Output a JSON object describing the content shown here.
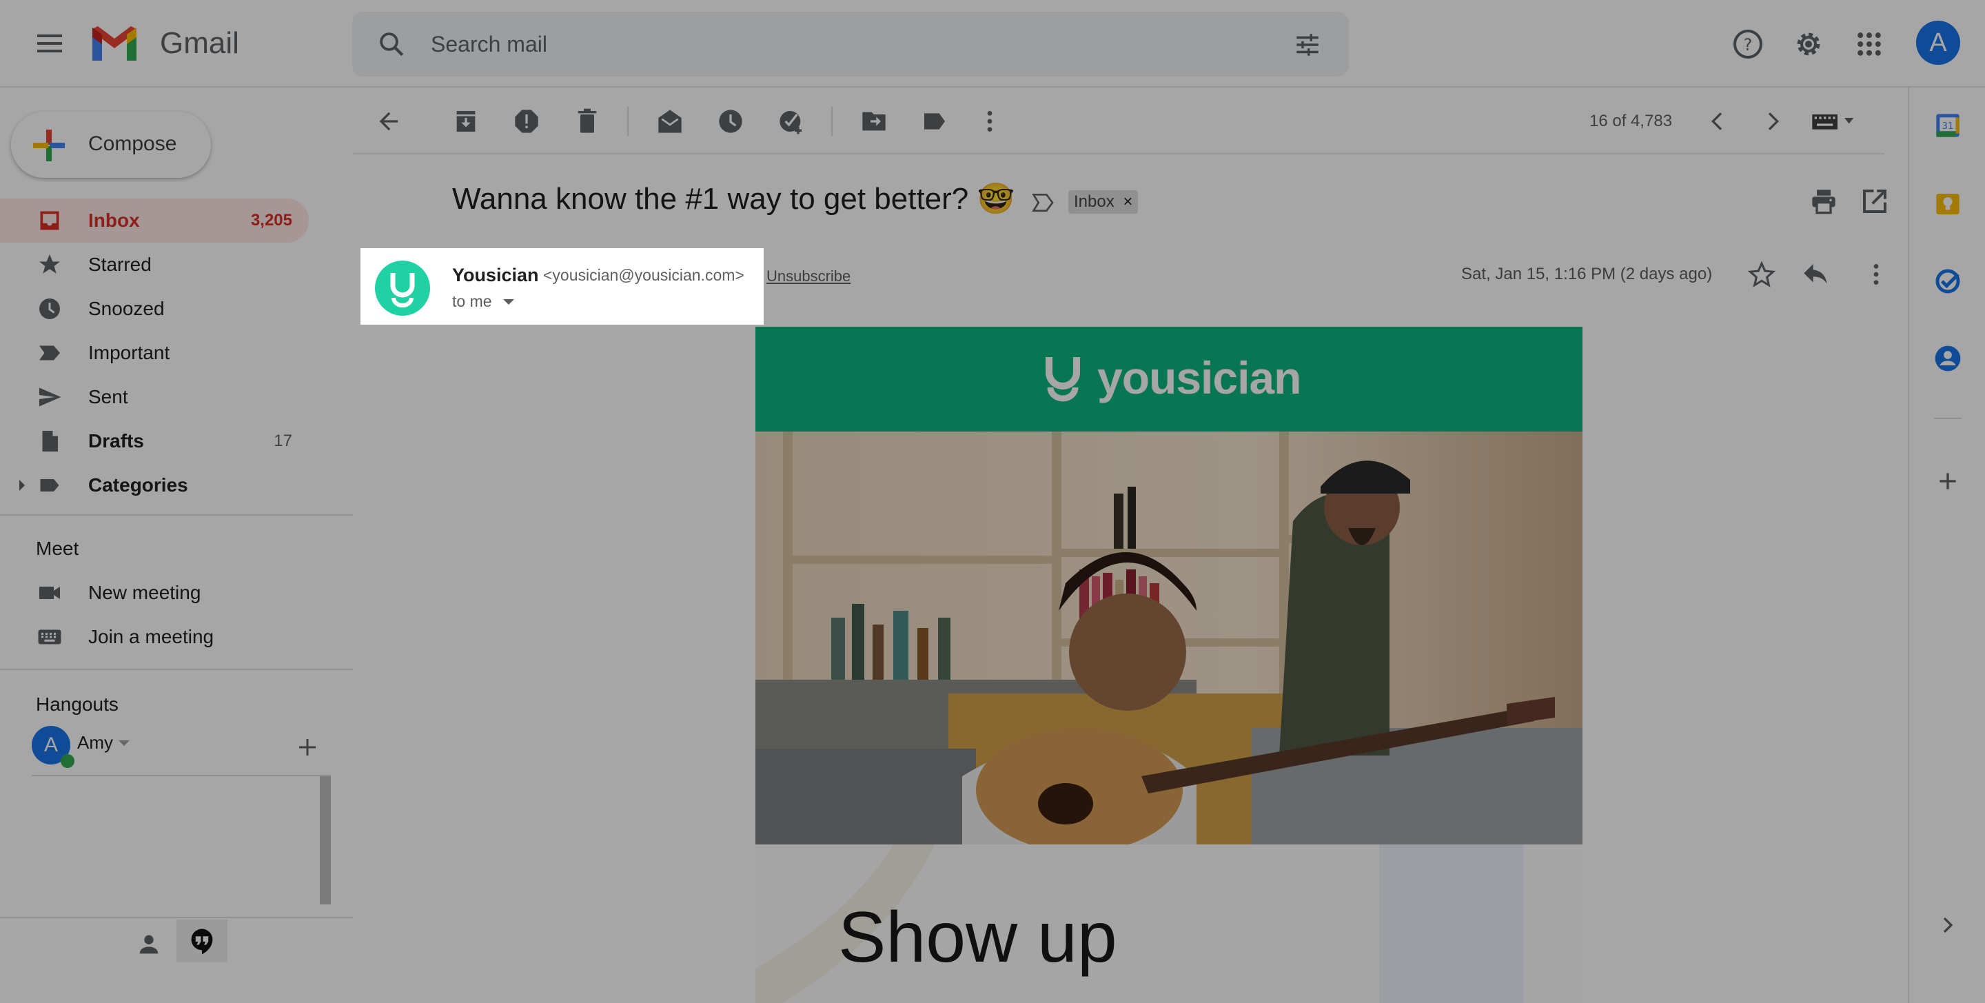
{
  "app": {
    "name": "Gmail",
    "colors": {
      "brand_red": "#d93025",
      "accent_blue": "#1a73e8",
      "yousician_green": "#0db580",
      "online_green": "#34a853"
    }
  },
  "header": {
    "menu_icon": "hamburger-menu-icon",
    "logo_text": "Gmail",
    "search": {
      "placeholder": "Search mail",
      "value": ""
    },
    "icons": [
      "search-icon",
      "filter-options-icon",
      "help-icon",
      "settings-gear-icon",
      "google-apps-icon"
    ],
    "account_initial": "A"
  },
  "sidebar": {
    "compose_label": "Compose",
    "items": [
      {
        "label": "Inbox",
        "count": "3,205",
        "icon": "inbox-icon",
        "active": true
      },
      {
        "label": "Starred",
        "count": "",
        "icon": "star-icon"
      },
      {
        "label": "Snoozed",
        "count": "",
        "icon": "clock-icon"
      },
      {
        "label": "Important",
        "count": "",
        "icon": "important-icon"
      },
      {
        "label": "Sent",
        "count": "",
        "icon": "send-icon"
      },
      {
        "label": "Drafts",
        "count": "17",
        "icon": "draft-icon",
        "bold": true
      },
      {
        "label": "Categories",
        "count": "",
        "icon": "label-icon",
        "bold": true,
        "expandable": true
      }
    ],
    "meet": {
      "title": "Meet",
      "items": [
        {
          "label": "New meeting",
          "icon": "video-camera-icon"
        },
        {
          "label": "Join a meeting",
          "icon": "keyboard-icon"
        }
      ]
    },
    "hangouts": {
      "title": "Hangouts",
      "user": {
        "initial": "A",
        "name": "Amy",
        "status": "online"
      }
    }
  },
  "toolbar": {
    "actions": [
      "Back to Inbox",
      "Archive",
      "Report spam",
      "Delete",
      "Mark as unread",
      "Snooze",
      "Add to Tasks",
      "Move to",
      "Labels",
      "More"
    ],
    "pager": "16 of 4,783"
  },
  "email": {
    "subject": "Wanna know the #1 way to get better? 🤓",
    "label_chip": "Inbox",
    "label_chip_close": "×",
    "sender_name": "Yousician",
    "sender_email": "<yousician@yousician.com>",
    "unsubscribe": "Unsubscribe",
    "recipient": "to me",
    "date": "Sat, Jan 15, 1:16 PM (2 days ago)",
    "body": {
      "banner_brand": "yousician",
      "photo_alt": "Two men smiling, one playing an acoustic guitar on a couch",
      "headline": "Show up"
    }
  },
  "side_panel": {
    "apps": [
      "Calendar",
      "Keep",
      "Tasks",
      "Contacts"
    ],
    "add_label": "Get add-ons",
    "calendar_day": "31"
  }
}
